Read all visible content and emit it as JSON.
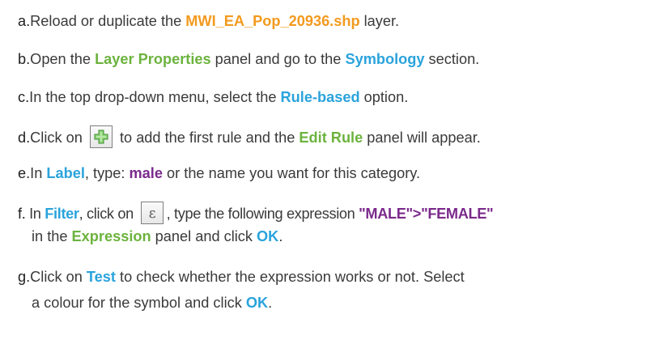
{
  "steps": [
    {
      "letter": "a.",
      "text1": "Reload or duplicate the ",
      "layer": "MWI_EA_Pop_20936.shp",
      "text2": " layer."
    },
    {
      "letter": "b.",
      "text1": "Open the ",
      "h1": "Layer Properties",
      "text2": " panel and go to the ",
      "h2": "Symbology",
      "text3": " section."
    },
    {
      "letter": "c.",
      "text1": "In the top drop-down menu, select the ",
      "h1": "Rule-based",
      "text2": " option."
    },
    {
      "letter": "d.",
      "text1": "Click on ",
      "text2": " to add the first rule and the ",
      "h1": "Edit Rule",
      "text3": " panel will appear.",
      "icon": "add-rule-icon"
    },
    {
      "letter": "e.",
      "text1": "In ",
      "h1": "Label",
      "text2": ", type: ",
      "h2": "male",
      "text3": " or the name you want for this category."
    },
    {
      "letter": "f.",
      "text1": " In ",
      "h1": "Filter",
      "text2": ", click on ",
      "text3": ", type the following expression ",
      "h2": "\"MALE\">\"FEMALE\"",
      "line2a": "in the ",
      "h3": "Expression",
      "line2b": " panel and click ",
      "h4": "OK",
      "line2c": ".",
      "icon": "expression-icon"
    },
    {
      "letter": "g.",
      "text1": "Click on ",
      "h1": "Test",
      "text2": " to check whether the expression works or not. Select",
      "line2a": "a colour for the symbol and click ",
      "h2": "OK",
      "line2b": "."
    }
  ],
  "colors": {
    "orange": "#f39a1e",
    "green": "#6cb33e",
    "blue": "#2aa3dc",
    "purple": "#7b2a8c",
    "text": "#3a3a3a"
  }
}
